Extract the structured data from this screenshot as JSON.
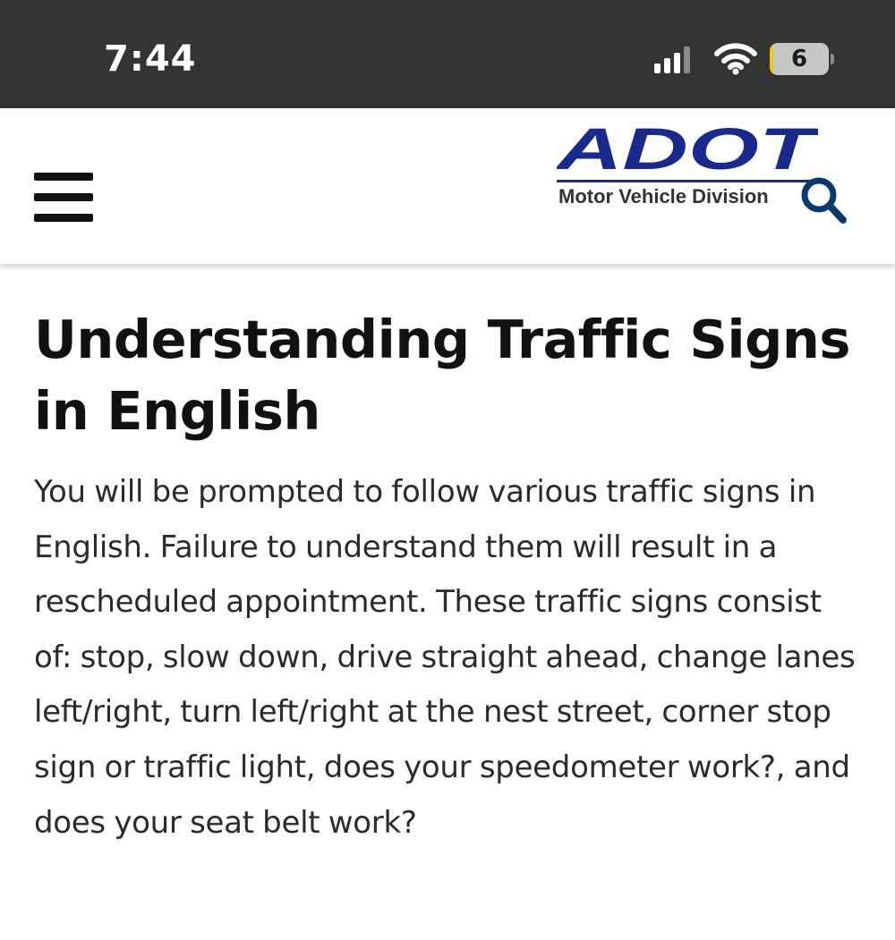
{
  "status_bar": {
    "time": "7:44",
    "battery_level": "6",
    "battery_color": "#f2c512"
  },
  "header": {
    "menu_icon": "hamburger-menu-icon",
    "logo": {
      "wordmark": "ADOT",
      "subtitle": "Motor Vehicle Division",
      "brand_color": "#1a2a8c"
    },
    "search_icon": "search-icon",
    "search_icon_color": "#0a3a6b"
  },
  "main": {
    "title": "Understanding Traffic Signs in English",
    "body": "You will be prompted to follow various traffic signs in English. Failure to understand them will result in a rescheduled appointment. These traffic signs consist of: stop, slow down, drive straight ahead, change lanes left/right, turn left/right at the nest street, corner stop sign or traffic light, does your speedometer work?, and does your seat belt work?"
  }
}
